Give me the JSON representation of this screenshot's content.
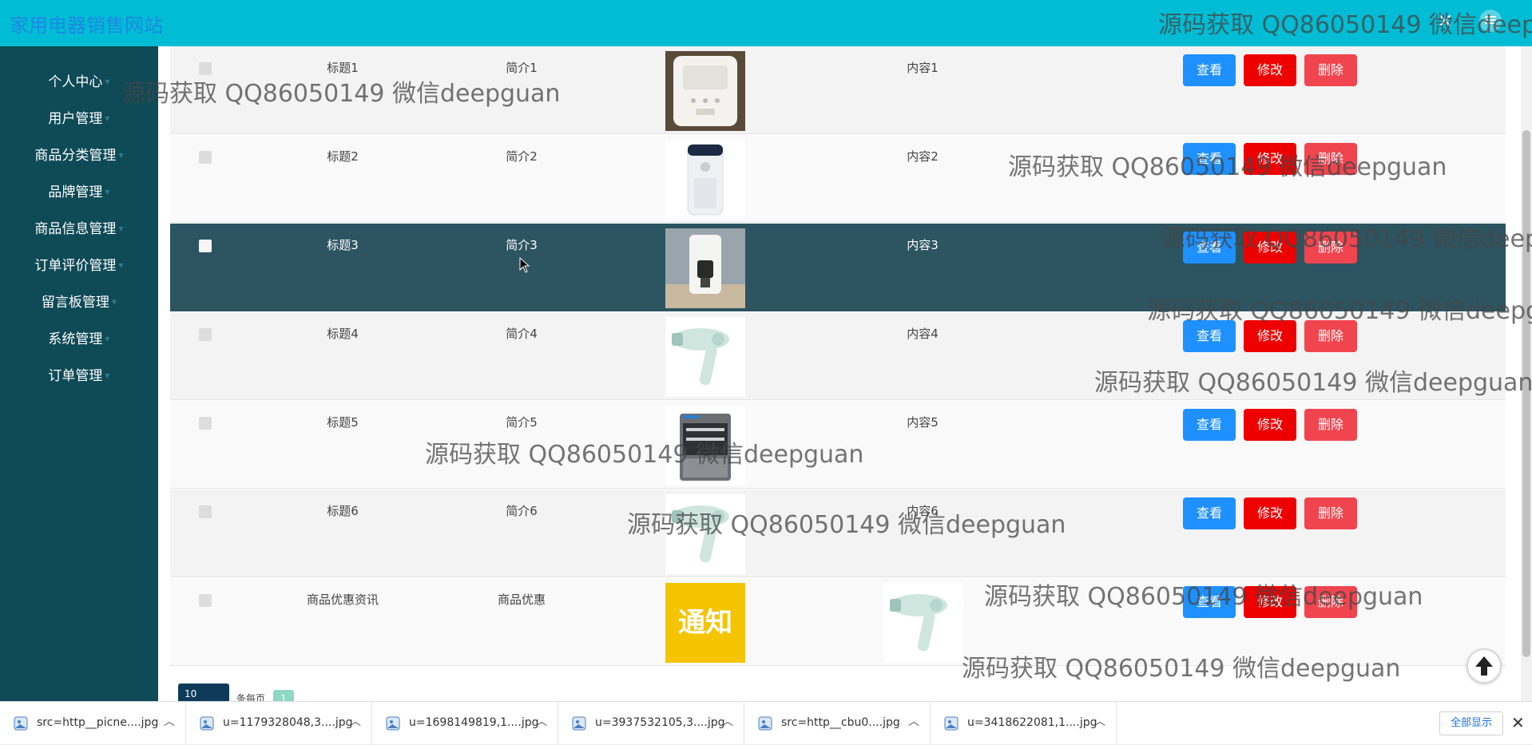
{
  "header": {
    "brand": "家用电器销售网站",
    "close_glyph": "×",
    "menu_glyph": "≡"
  },
  "sidebar": {
    "items": [
      {
        "label": "个人中心"
      },
      {
        "label": "用户管理"
      },
      {
        "label": "商品分类管理"
      },
      {
        "label": "品牌管理"
      },
      {
        "label": "商品信息管理"
      },
      {
        "label": "订单评价管理"
      },
      {
        "label": "留言板管理"
      },
      {
        "label": "系统管理"
      },
      {
        "label": "订单管理"
      }
    ]
  },
  "table": {
    "rows": [
      {
        "title": "标题1",
        "intro": "简介1",
        "content": "内容1",
        "image": "rice-cooker"
      },
      {
        "title": "标题2",
        "intro": "简介2",
        "content": "内容2",
        "image": "air-purifier"
      },
      {
        "title": "标题3",
        "intro": "简介3",
        "content": "内容3",
        "image": "water-dispenser"
      },
      {
        "title": "标题4",
        "intro": "简介4",
        "content": "内容4",
        "image": "hair-dryer"
      },
      {
        "title": "标题5",
        "intro": "简介5",
        "content": "内容5",
        "image": "dishwasher"
      },
      {
        "title": "标题6",
        "intro": "简介6",
        "content": "内容6",
        "image": "hair-dryer"
      },
      {
        "title": "商品优惠资讯",
        "intro": "商品优惠",
        "content": "",
        "image": "notice",
        "image2": "hair-dryer"
      }
    ],
    "buttons": {
      "view": "查看",
      "edit": "修改",
      "delete": "删除"
    },
    "notice_text": "通知"
  },
  "pagination": {
    "page_size": "10",
    "per_page_label": "条每页",
    "current_page": "1"
  },
  "downloads": {
    "items": [
      {
        "name": "src=http__picne....jpg"
      },
      {
        "name": "u=1179328048,3....jpg"
      },
      {
        "name": "u=1698149819,1....jpg"
      },
      {
        "name": "u=3937532105,3....jpg"
      },
      {
        "name": "src=http__cbu0....jpg"
      },
      {
        "name": "u=3418622081,1....jpg"
      }
    ],
    "show_all": "全部显示"
  },
  "watermark": "源码获取 QQ86050149 微信deepguan",
  "colors": {
    "header": "#00bcd4",
    "sidebar": "#0f4a57",
    "highlight_row": "#2c5461",
    "view_button": "#1e90ff",
    "edit_button": "#ee0000",
    "delete_button": "#f0454f"
  }
}
